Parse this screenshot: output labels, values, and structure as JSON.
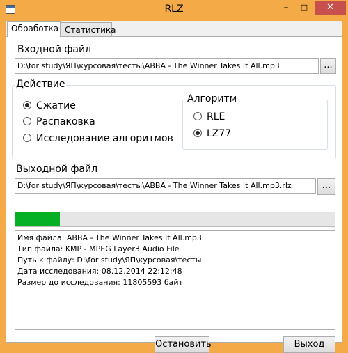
{
  "window": {
    "title": "RLZ",
    "controls": {
      "minimize": "–",
      "maximize": "□",
      "close": "✕"
    }
  },
  "tabs": [
    {
      "label": "Обработка",
      "active": true
    },
    {
      "label": "Статистика",
      "active": false
    }
  ],
  "input": {
    "label": "Входной файл",
    "value": "D:\\for study\\ЯП\\курсовая\\тесты\\ABBA - The Winner Takes It All.mp3",
    "browse_label": "..."
  },
  "action": {
    "label": "Действие",
    "options": [
      {
        "label": "Сжатие",
        "checked": true
      },
      {
        "label": "Распаковка",
        "checked": false
      },
      {
        "label": "Исследование алгоритмов",
        "checked": false
      }
    ]
  },
  "algorithm": {
    "label": "Алгоритм",
    "options": [
      {
        "label": "RLE",
        "checked": false
      },
      {
        "label": "LZ77",
        "checked": true
      }
    ]
  },
  "output": {
    "label": "Выходной файл",
    "value": "D:\\for study\\ЯП\\курсовая\\тесты\\ABBA - The Winner Takes It All.mp3.rlz",
    "browse_label": "..."
  },
  "progress": {
    "fraction": 0.14,
    "color": "#06b025"
  },
  "log": [
    "Имя файла: ABBA - The Winner Takes It All.mp3",
    "Тип файла: KMP - MPEG Layer3 Audio File",
    "Путь к файлу: D:\\for study\\ЯП\\курсовая\\тесты",
    "Дата исследования: 08.12.2014 22:12:48",
    "Размер до исследования: 11805593 байт"
  ],
  "buttons": {
    "stop": "Остановить",
    "exit": "Выход"
  },
  "colors": {
    "frame": "#f3aa47",
    "close": "#c7504f"
  }
}
